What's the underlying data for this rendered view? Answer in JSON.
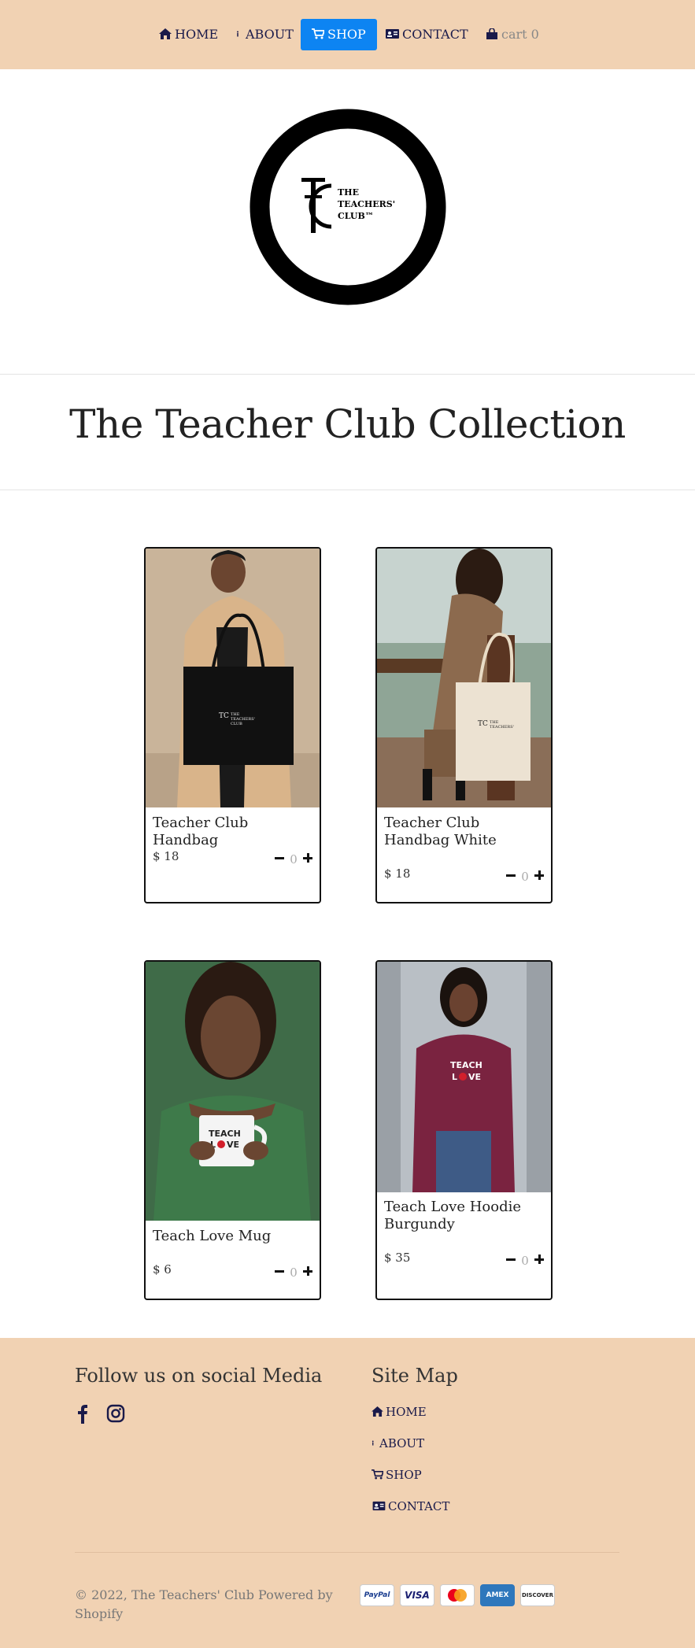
{
  "nav": {
    "items": [
      {
        "label": "HOME"
      },
      {
        "label": "ABOUT"
      },
      {
        "label": "SHOP"
      },
      {
        "label": "CONTACT"
      },
      {
        "label": "cart 0"
      }
    ]
  },
  "logo": {
    "line1": "THE",
    "line2": "TEACHERS'",
    "line3": "CLUB™"
  },
  "collection": {
    "title": "The Teacher Club Collection"
  },
  "products": [
    {
      "name": "Teacher Club Handbag",
      "price": "$ 18",
      "qty": "0"
    },
    {
      "name": "Teacher Club Handbag White",
      "price": "$ 18",
      "qty": "0"
    },
    {
      "name": "Teach Love Mug",
      "price": "$ 6",
      "qty": "0"
    },
    {
      "name": "Teach Love Hoodie Burgundy",
      "price": "$ 35",
      "qty": "0"
    }
  ],
  "footer": {
    "social_heading": "Follow us on social Media",
    "sitemap_heading": "Site Map",
    "sitemap": [
      {
        "label": "HOME"
      },
      {
        "label": "ABOUT"
      },
      {
        "label": "SHOP"
      },
      {
        "label": "CONTACT"
      }
    ],
    "copyright": "© 2022, The Teachers' Club Powered by Shopify",
    "payments": [
      "PayPal",
      "VISA",
      "Mastercard",
      "AMEX",
      "DISCOVER"
    ]
  },
  "colors": {
    "nav_bg": "#f1d2b3",
    "active": "#0d84f2",
    "footer_bg": "#f1d2b3"
  }
}
